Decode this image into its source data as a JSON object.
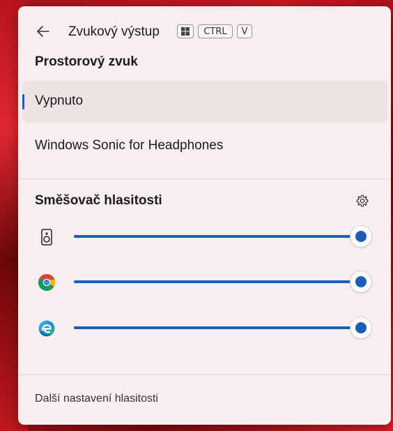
{
  "header": {
    "title": "Zvukový výstup",
    "shortcut_keys": [
      "CTRL",
      "V"
    ]
  },
  "spatial_sound": {
    "title": "Prostorový zvuk",
    "options": [
      {
        "label": "Vypnuto",
        "selected": true
      },
      {
        "label": "Windows Sonic for Headphones",
        "selected": false
      }
    ]
  },
  "mixer": {
    "title": "Směšovač hlasitosti",
    "rows": [
      {
        "icon": "speaker-icon",
        "volume": 1.0
      },
      {
        "icon": "chrome-icon",
        "volume": 1.0
      },
      {
        "icon": "edge-icon",
        "volume": 1.0
      }
    ]
  },
  "footer": {
    "link": "Další nastavení hlasitosti"
  },
  "colors": {
    "accent": "#1c5db8",
    "panel_bg": "#f7efef",
    "selected_bg": "#ece3e3"
  }
}
